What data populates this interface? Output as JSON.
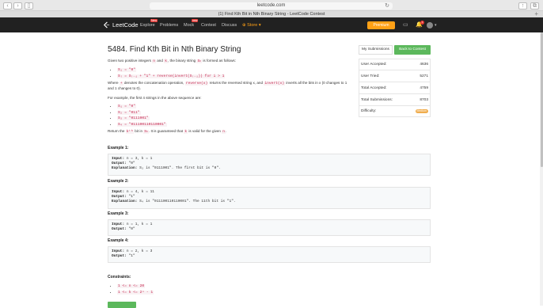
{
  "browser": {
    "address": "leetcode.com",
    "tab_title": "(1) Find Kth Bit in Nth Binary String - LeetCode Contest"
  },
  "nav": {
    "brand": "LeetCode",
    "items": [
      "Explore",
      "Problems",
      "Mock",
      "Contest",
      "Discuss",
      "Store"
    ],
    "explore_badge": "New",
    "mock_badge": "new",
    "store_arrow": "▾",
    "premium": "Premium",
    "notification_count": "1"
  },
  "problem": {
    "title": "5484. Find Kth Bit in Nth Binary String",
    "intro_1": "Given two positive integers",
    "intro_n": "n",
    "intro_and": "and",
    "intro_k": "k",
    "intro_2": ", the binary string",
    "intro_sn": "Sₙ",
    "intro_3": "is formed as follows:",
    "rule_1": "S₁ = \"0\"",
    "rule_2": "Sᵢ = Sᵢ₋₁ + \"1\" + reverse(invert(Sᵢ₋₁)) for i > 1",
    "where_1": "Where",
    "where_plus": "+",
    "where_2": "denotes the concatenation operation,",
    "where_rev": "reverse(x)",
    "where_3": "returns the reversed string x, and",
    "where_inv": "invert(x)",
    "where_4": "inverts all the bits in x (0 changes to 1 and 1 changes to 0).",
    "example_text": "For example, the first 4 strings in the above sequence are:",
    "seq": [
      "S₁ = \"0\"",
      "S₂ = \"011\"",
      "S₃ = \"0111001\"",
      "S₄ = \"011100110110001\""
    ],
    "return_1": "Return the",
    "return_kth": "kᵗʰ",
    "return_2": "bit in",
    "return_sn": "Sₙ",
    "return_3": ". It is guaranteed that",
    "return_k": "k",
    "return_4": "is valid for the given",
    "return_n": "n",
    "return_5": "."
  },
  "examples": [
    {
      "heading": "Example 1:",
      "input": "n = 3, k = 1",
      "output": "\"0\"",
      "explanation": "S₃ is \"0111001\". The first bit is \"0\"."
    },
    {
      "heading": "Example 2:",
      "input": "n = 4, k = 11",
      "output": "\"1\"",
      "explanation": "S₄ is \"011100110110001\". The 11th bit is \"1\"."
    },
    {
      "heading": "Example 3:",
      "input": "n = 1, k = 1",
      "output": "\"0\""
    },
    {
      "heading": "Example 4:",
      "input": "n = 2, k = 3",
      "output": "\"1\""
    }
  ],
  "labels": {
    "input": "Input:",
    "output": "Output:",
    "explanation": "Explanation:"
  },
  "constraints": {
    "heading": "Constraints:",
    "items": [
      "1 <= n <= 20",
      "1 <= k <= 2ⁿ - 1"
    ]
  },
  "sidebar": {
    "my_submissions": "My Submissions",
    "back_to_contest": "Back to Contest",
    "stats": [
      {
        "label": "User Accepted:",
        "value": "4636"
      },
      {
        "label": "User Tried:",
        "value": "5271"
      },
      {
        "label": "Total Accepted:",
        "value": "4759"
      },
      {
        "label": "Total Submissions:",
        "value": "8703"
      },
      {
        "label": "Difficulty:",
        "value": "Medium"
      }
    ]
  },
  "colors": {
    "nav_bg": "#212121",
    "accent": "#ffa116",
    "green": "#5cb85c",
    "code_red": "#c7254e"
  }
}
